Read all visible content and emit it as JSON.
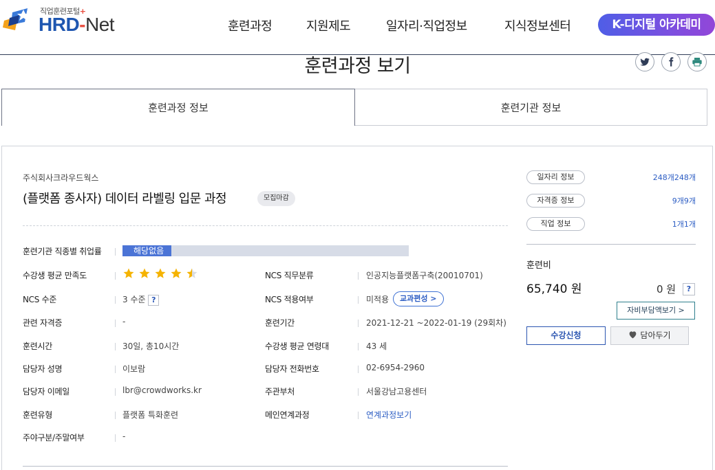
{
  "header": {
    "logo_sub": "직업훈련포털",
    "logo_plus": "+",
    "logo_main": "HRD",
    "logo_dash": "-",
    "logo_net": "Net",
    "nav": [
      "훈련과정",
      "지원제도",
      "일자리·직업정보",
      "지식정보센터"
    ],
    "highlight_button": "K-디지털 아카데미"
  },
  "page": {
    "title": "훈련과정 보기",
    "share_icons": [
      "twitter-icon",
      "facebook-icon",
      "print-icon"
    ]
  },
  "tabs": [
    {
      "label": "훈련과정 정보",
      "active": true
    },
    {
      "label": "훈련기관 정보",
      "active": false
    }
  ],
  "course": {
    "org_name": "주식회사크라우드웍스",
    "title": "(플랫폼 종사자) 데이터 라벨링 입문 과정",
    "status_badge": "모집마감"
  },
  "details": {
    "employment_rate_label": "훈련기관 직종별 취업률",
    "employment_rate_value": "해당없음",
    "employment_rate_fill": 0.17,
    "satisfaction_label": "수강생 평균 만족도",
    "satisfaction_stars": 4.5,
    "ncs_level_label": "NCS 수준",
    "ncs_level_value": "3 수준",
    "cert_label": "관련 자격증",
    "cert_value": "-",
    "hours_label": "훈련시간",
    "hours_value": "30일, 총10시간",
    "manager_label": "담당자 성명",
    "manager_value": "이보람",
    "email_label": "담당자 이메일",
    "email_value": "lbr@crowdworks.kr",
    "type_label": "훈련유형",
    "type_value": "플랫폼 특화훈련",
    "daynight_label": "주야구분/주말여부",
    "daynight_value": "-",
    "ncs_job_label": "NCS 직무분류",
    "ncs_job_value": "인공지능플랫폼구축(20010701)",
    "ncs_apply_label": "NCS 적용여부",
    "ncs_apply_value": "미적용",
    "curriculum_button": "교과편성 >",
    "period_label": "훈련기간",
    "period_value": "2021-12-21 ~2022-01-19 (29회차)",
    "age_label": "수강생 평균 연령대",
    "age_value": "43 세",
    "phone_label": "담당자 전화번호",
    "phone_value": "02-6954-2960",
    "dept_label": "주관부처",
    "dept_value": "서울강남고용센터",
    "linked_label": "메인연계과정",
    "linked_value": "연계과정보기",
    "help_mark": "?"
  },
  "side": {
    "items": [
      {
        "label": "일자리 정보",
        "count": "248개248개"
      },
      {
        "label": "자격증 정보",
        "count": "9개9개"
      },
      {
        "label": "직업 정보",
        "count": "1개1개"
      }
    ],
    "fee_label": "훈련비",
    "fee_amount": "65,740 원",
    "fee_zero": "0 원",
    "self_pay_button": "자비부담액보기 >",
    "apply_button": "수강신청",
    "wishlist_button": "담아두기"
  },
  "colors": {
    "brand_blue": "#1e56b0",
    "accent_red": "#e94b3c",
    "link_blue": "#2b5cc3",
    "star": "#f5b301",
    "kdigital_gradient_start": "#4f5ee6",
    "kdigital_gradient_end": "#9246d8"
  }
}
